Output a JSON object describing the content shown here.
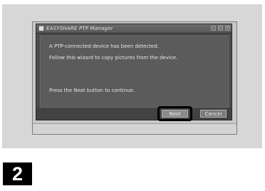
{
  "dialog": {
    "title": "EASYSHARE PTP Manager",
    "title_buttons": [
      "–",
      "□",
      "×"
    ],
    "lines": [
      "A PTP-connected device has been detected.",
      "Follow this wizard to copy pictures from the device.",
      "Press the Next button to continue."
    ],
    "next_label": "Next",
    "cancel_label": "Cancel"
  },
  "step": {
    "number": "2"
  }
}
